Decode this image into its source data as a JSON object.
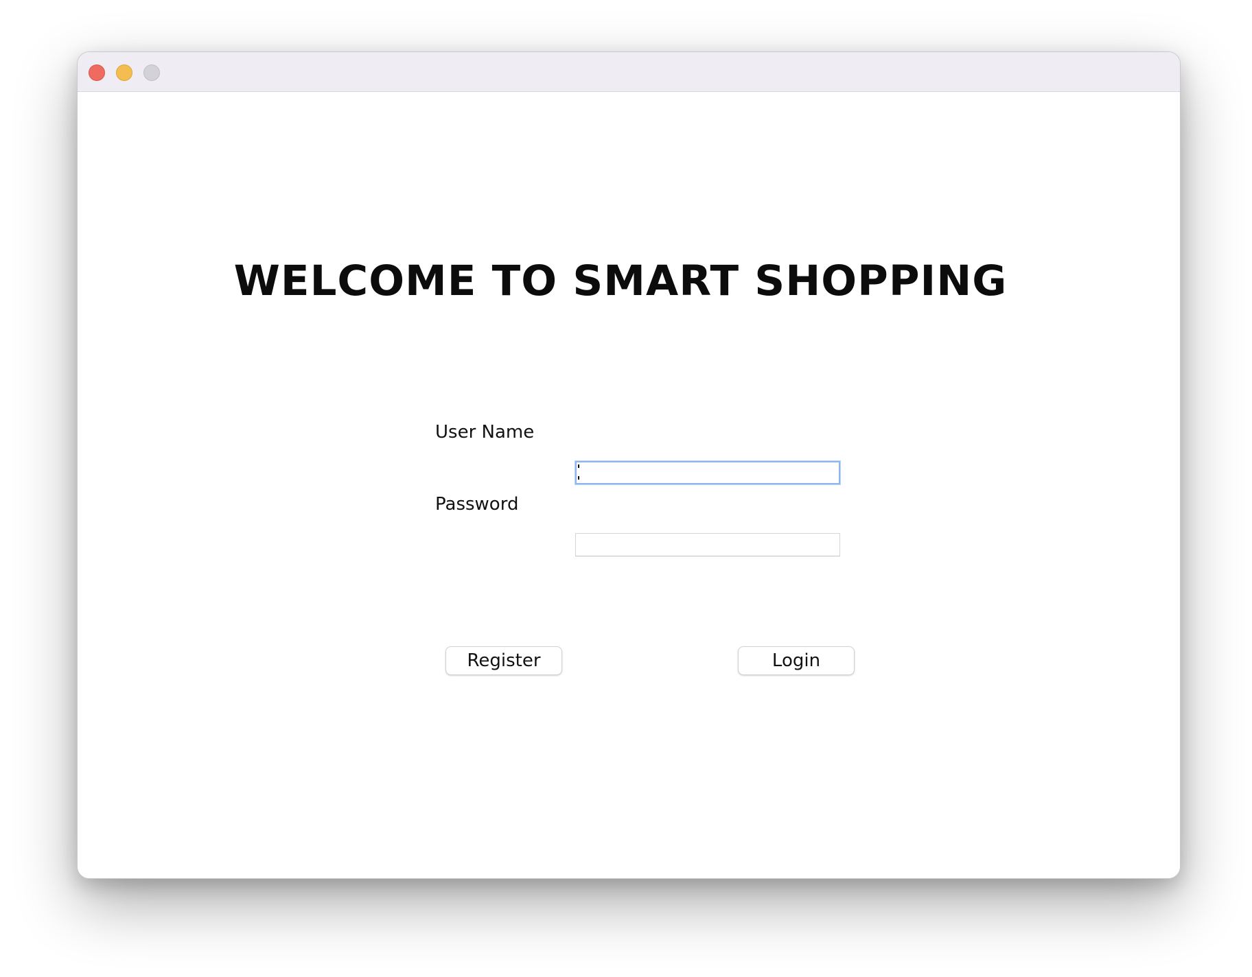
{
  "window": {
    "controls": {
      "close_icon": "close-icon",
      "minimize_icon": "minimize-icon",
      "maximize_icon": "maximize-icon",
      "close_color": "#ef6b5f",
      "minimize_color": "#f4bd4f",
      "maximize_color": "#d4d2d9"
    }
  },
  "main": {
    "heading": "WELCOME TO SMART SHOPPING"
  },
  "form": {
    "username": {
      "label": "User Name",
      "value": "",
      "placeholder": "",
      "focused": true,
      "focus_color": "#8fb6ec"
    },
    "password": {
      "label": "Password",
      "value": "",
      "placeholder": ""
    }
  },
  "buttons": {
    "register_label": "Register",
    "login_label": "Login"
  }
}
